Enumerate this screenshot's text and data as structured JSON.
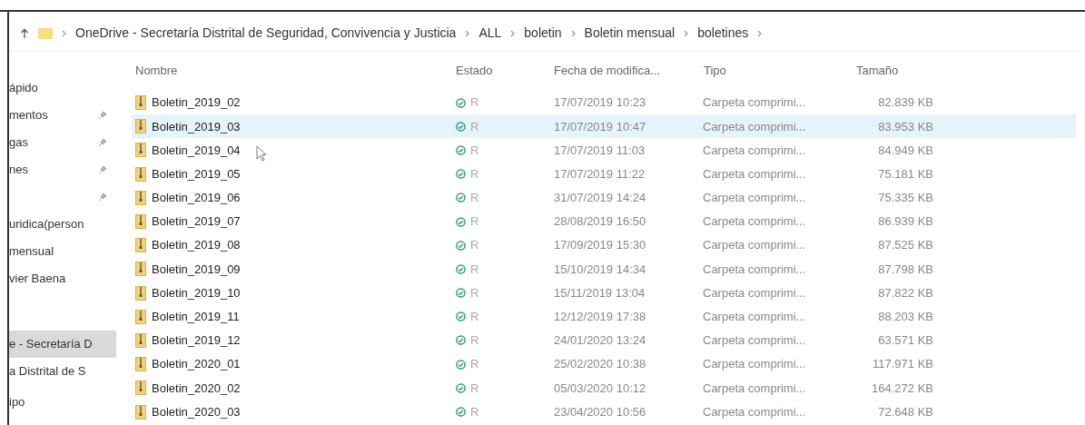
{
  "address_bar": {
    "path": [
      "OneDrive - Secretaría Distrital de Seguridad, Convivencia y Justicia",
      "ALL",
      "boletin",
      "Boletin mensual",
      "boletines"
    ]
  },
  "sidebar": {
    "groups": [
      {
        "items": [
          {
            "label": "ápido",
            "pinned": false,
            "selected": false
          },
          {
            "label": "mentos",
            "pinned": true,
            "selected": false
          },
          {
            "label": "gas",
            "pinned": true,
            "selected": false
          },
          {
            "label": "nes",
            "pinned": true,
            "selected": false
          },
          {
            "pinned": true,
            "selected": false
          },
          {
            "label": "uridica(person",
            "pinned": false,
            "selected": false
          },
          {
            "label": "mensual",
            "pinned": false,
            "selected": false
          },
          {
            "label": "vier Baena",
            "pinned": false,
            "selected": false
          }
        ]
      },
      {
        "items": [
          {
            "label": "e - Secretaría D",
            "pinned": false,
            "selected": true
          },
          {
            "label": "a Distrital de S",
            "pinned": false,
            "selected": false
          }
        ]
      },
      {
        "items": [
          {
            "label": "ipo",
            "pinned": false,
            "selected": false
          }
        ]
      }
    ]
  },
  "table": {
    "columns": [
      "Nombre",
      "Estado",
      "Fecha de modifica...",
      "Tipo",
      "Tamaño"
    ],
    "rows": [
      {
        "name": "Boletin_2019_02",
        "status": "R",
        "date": "17/07/2019 10:23",
        "type": "Carpeta comprimi...",
        "size": "82.839 KB",
        "selected": false
      },
      {
        "name": "Boletin_2019_03",
        "status": "R",
        "date": "17/07/2019 10:47",
        "type": "Carpeta comprimi...",
        "size": "83.953 KB",
        "selected": true
      },
      {
        "name": "Boletin_2019_04",
        "status": "R",
        "date": "17/07/2019 11:03",
        "type": "Carpeta comprimi...",
        "size": "84.949 KB",
        "selected": false
      },
      {
        "name": "Boletin_2019_05",
        "status": "R",
        "date": "17/07/2019 11:22",
        "type": "Carpeta comprimi...",
        "size": "75.181 KB",
        "selected": false
      },
      {
        "name": "Boletin_2019_06",
        "status": "R",
        "date": "31/07/2019 14:24",
        "type": "Carpeta comprimi...",
        "size": "75.335 KB",
        "selected": false
      },
      {
        "name": "Boletin_2019_07",
        "status": "R",
        "date": "28/08/2019 16:50",
        "type": "Carpeta comprimi...",
        "size": "86.939 KB",
        "selected": false
      },
      {
        "name": "Boletin_2019_08",
        "status": "R",
        "date": "17/09/2019 15:30",
        "type": "Carpeta comprimi...",
        "size": "87.525 KB",
        "selected": false
      },
      {
        "name": "Boletin_2019_09",
        "status": "R",
        "date": "15/10/2019 14:34",
        "type": "Carpeta comprimi...",
        "size": "87.798 KB",
        "selected": false
      },
      {
        "name": "Boletin_2019_10",
        "status": "R",
        "date": "15/11/2019 13:04",
        "type": "Carpeta comprimi...",
        "size": "87.822 KB",
        "selected": false
      },
      {
        "name": "Boletin_2019_11",
        "status": "R",
        "date": "12/12/2019 17:38",
        "type": "Carpeta comprimi...",
        "size": "88.203 KB",
        "selected": false
      },
      {
        "name": "Boletin_2019_12",
        "status": "R",
        "date": "24/01/2020 13:24",
        "type": "Carpeta comprimi...",
        "size": "63.571 KB",
        "selected": false
      },
      {
        "name": "Boletin_2020_01",
        "status": "R",
        "date": "25/02/2020 10:38",
        "type": "Carpeta comprimi...",
        "size": "117.971 KB",
        "selected": false
      },
      {
        "name": "Boletin_2020_02",
        "status": "R",
        "date": "05/03/2020 10:12",
        "type": "Carpeta comprimi...",
        "size": "164.272 KB",
        "selected": false
      },
      {
        "name": "Boletin_2020_03",
        "status": "R",
        "date": "23/04/2020 10:56",
        "type": "Carpeta comprimi...",
        "size": "72.648 KB",
        "selected": false
      }
    ]
  }
}
